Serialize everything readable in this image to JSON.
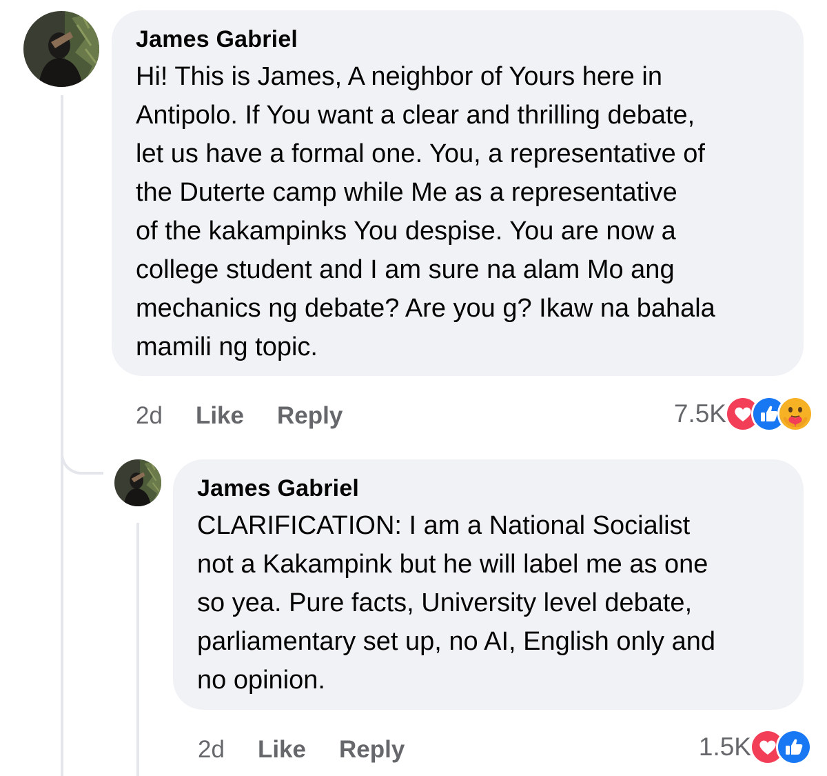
{
  "comment": {
    "author": "James Gabriel",
    "text": "Hi! This is James, A neighbor of Yours here in\nAntipolo. If You want a clear and thrilling debate,\nlet us have a formal one. You, a representative of\nthe Duterte camp while Me as a representative\nof the kakampinks You despise. You are now a\ncollege student and I am sure na alam Mo ang\nmechanics ng debate? Are you g? Ikaw na bahala\nmamili ng topic.",
    "time": "2d",
    "like_label": "Like",
    "reply_label": "Reply",
    "reaction_count": "7.5K",
    "reactions": [
      "heart-reaction-icon",
      "like-reaction-icon",
      "care-reaction-icon"
    ]
  },
  "reply": {
    "author": "James Gabriel",
    "text": "CLARIFICATION: I am a National Socialist\nnot a Kakampink but he will label me as one\nso yea. Pure facts, University level debate,\nparliamentary set up, no AI, English only and\nno opinion.",
    "time": "2d",
    "like_label": "Like",
    "reply_label": "Reply",
    "reaction_count": "1.5K",
    "reactions": [
      "heart-reaction-icon",
      "like-reaction-icon"
    ]
  },
  "colors": {
    "bubble": "#f0f2f5",
    "meta_text": "#65676b",
    "heart": "#f33e58",
    "like": "#1877f2",
    "care": "#f7b125"
  }
}
